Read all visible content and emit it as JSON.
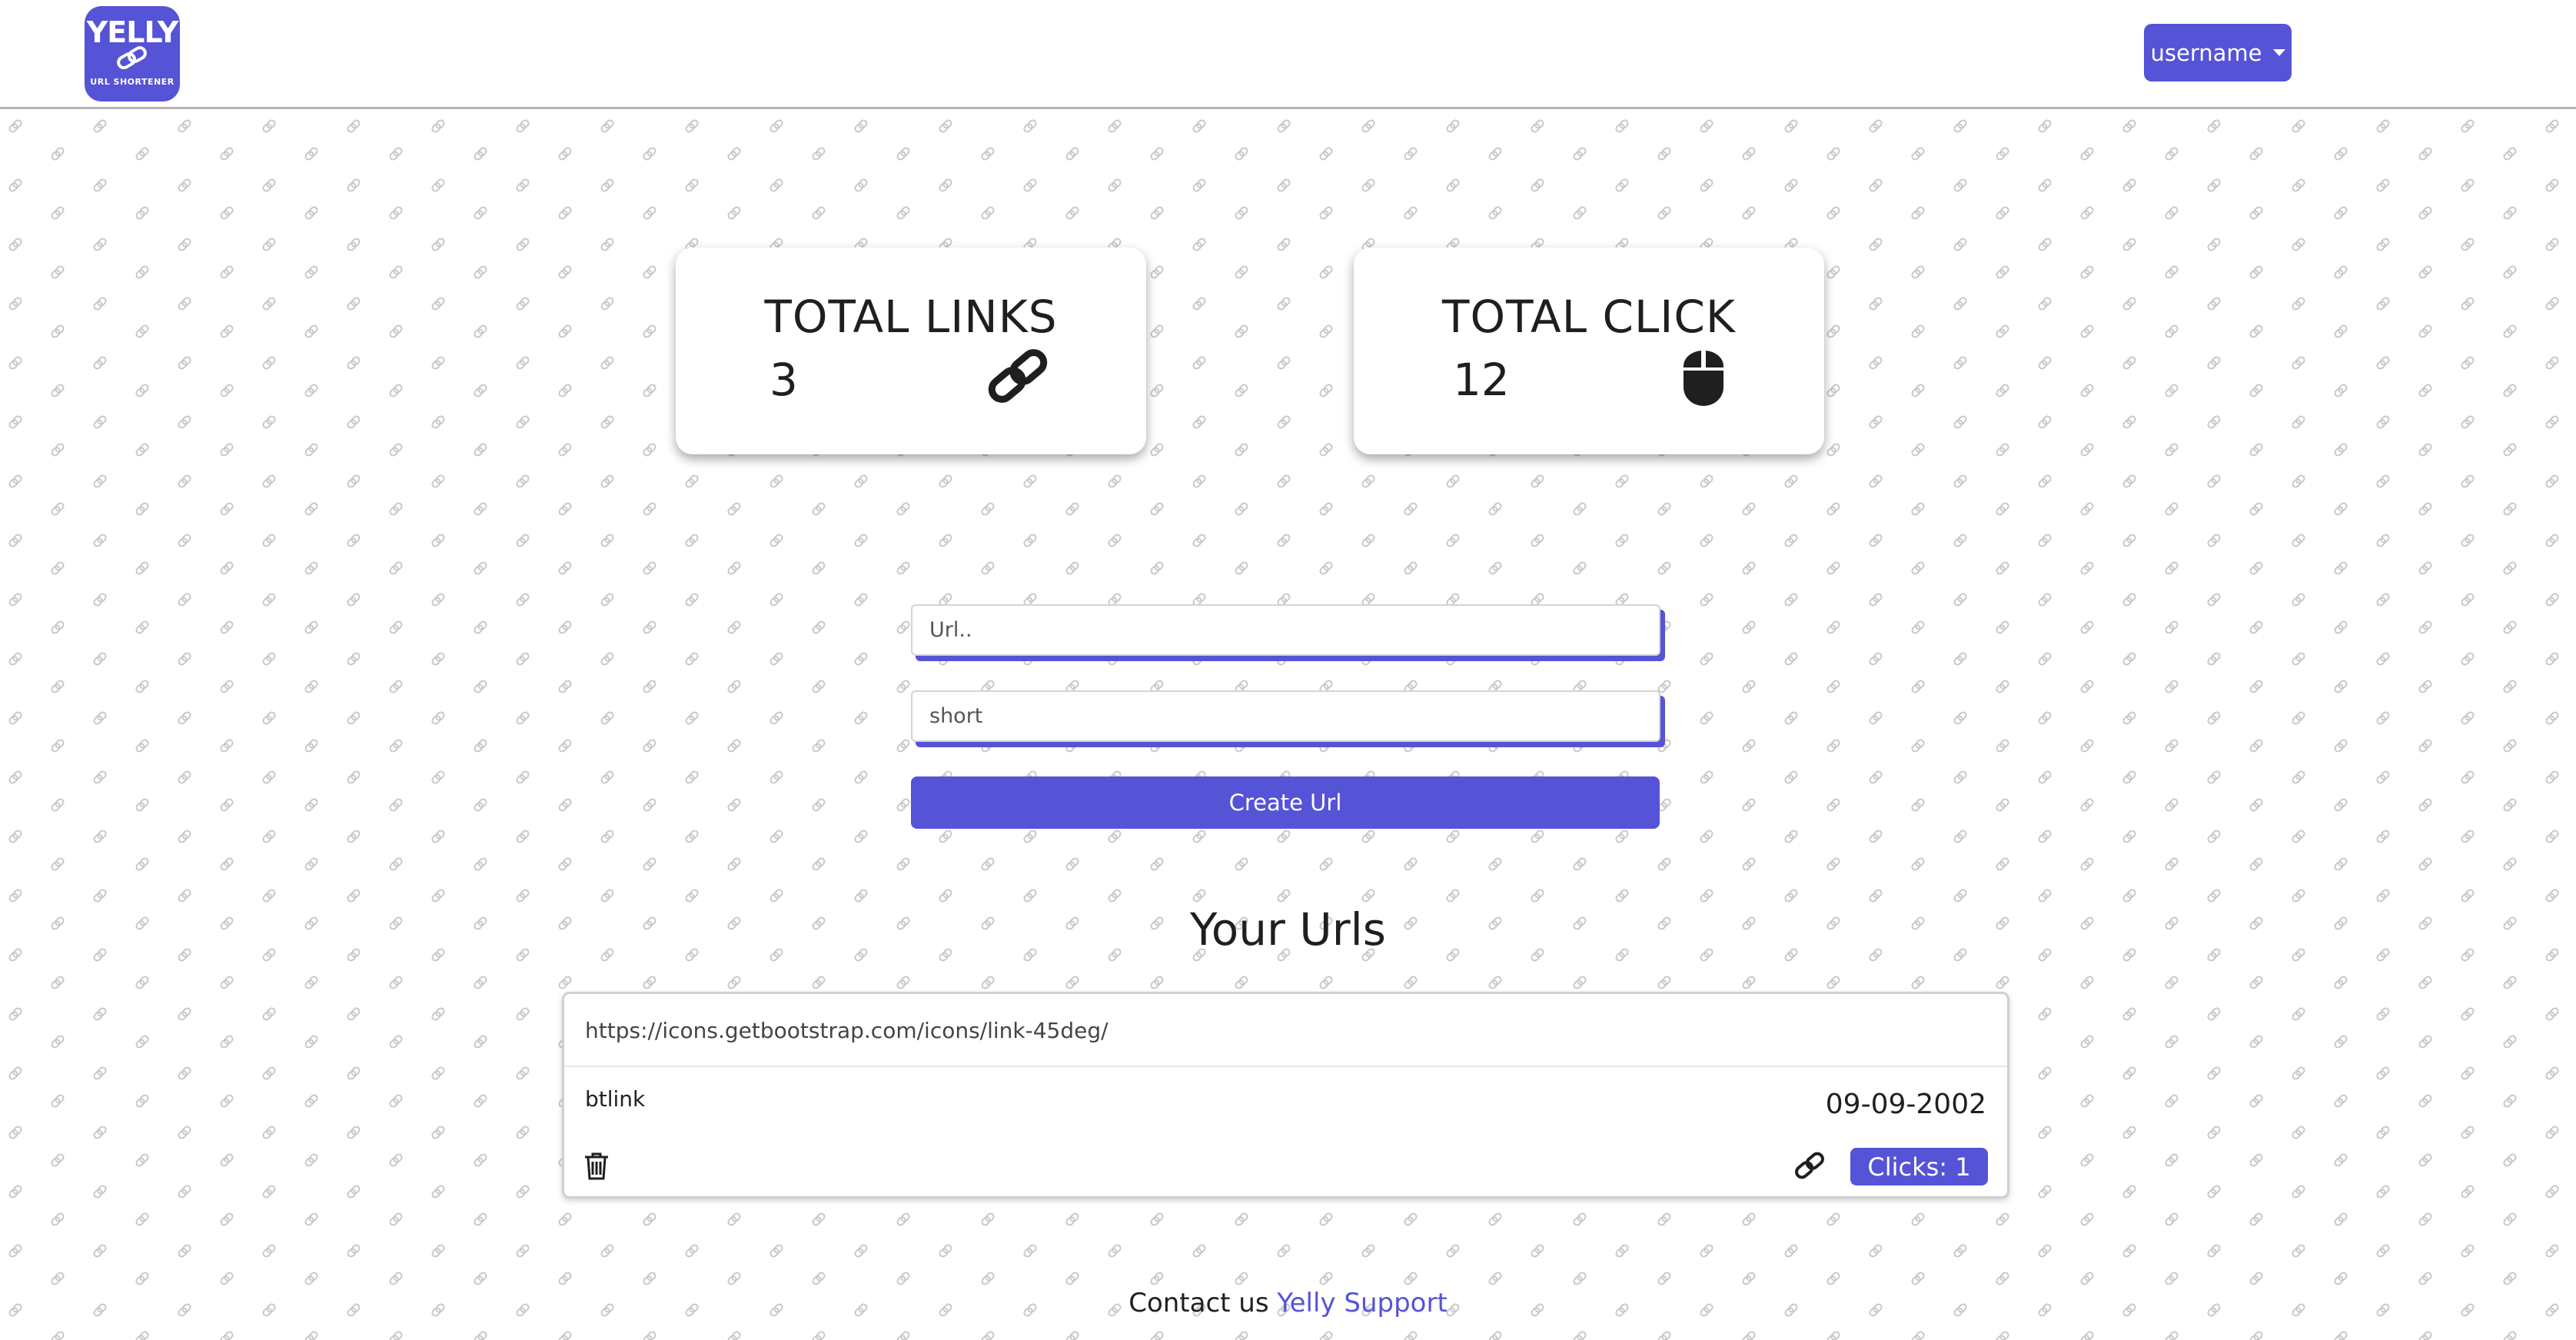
{
  "header": {
    "logo": {
      "word": "YELLY",
      "sub": "URL SHORTENER",
      "icon": "chain-link-icon"
    },
    "user_menu_label": "username"
  },
  "stats": {
    "total_links": {
      "title": "TOTAL LINKS",
      "value": "3",
      "icon": "link-45deg-icon"
    },
    "total_click": {
      "title": "TOTAL CLICK",
      "value": "12",
      "icon": "mouse-icon"
    }
  },
  "form": {
    "url_placeholder": "Url..",
    "url_value": "",
    "short_placeholder": "short",
    "short_value": "",
    "create_label": "Create Url"
  },
  "urls": {
    "title": "Your Urls",
    "items": [
      {
        "url": "https://icons.getbootstrap.com/icons/link-45deg/",
        "short": "btlink",
        "date": "09-09-2002",
        "clicks_label": "Clicks: 1"
      }
    ]
  },
  "footer": {
    "prefix": "Contact us",
    "link_label": "Yelly Support"
  },
  "colors": {
    "accent": "#5553d6",
    "text": "#1f1f1f",
    "pattern": "#c9c9c9"
  }
}
